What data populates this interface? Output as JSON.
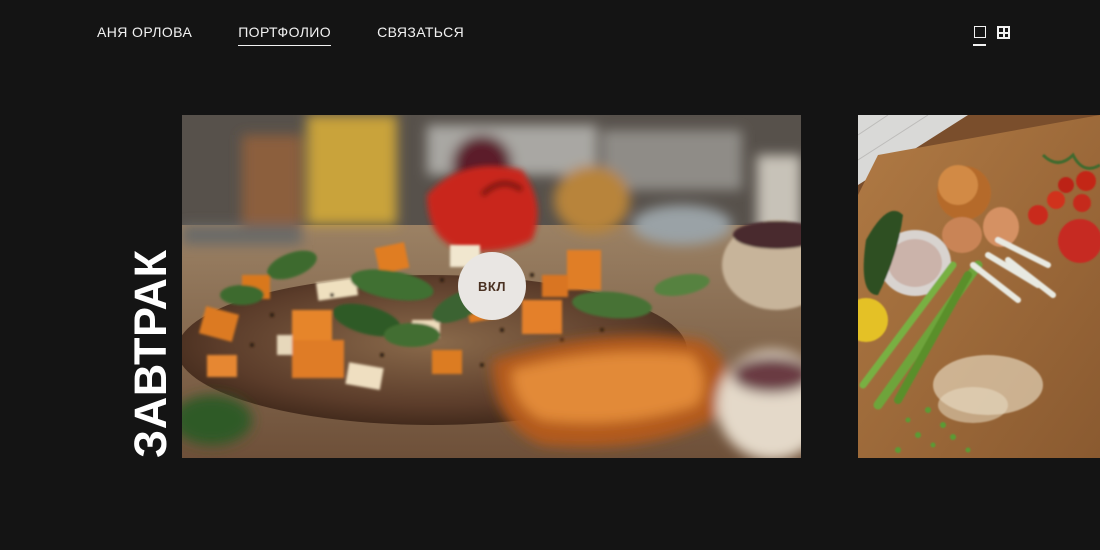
{
  "nav": {
    "items": [
      {
        "label": "АНЯ ОРЛОВА"
      },
      {
        "label": "ПОРТФОЛИО",
        "active": true
      },
      {
        "label": "СВЯЗАТЬСЯ"
      }
    ]
  },
  "view_toggle": {
    "icons": [
      "single-view-icon",
      "grid-view-icon"
    ],
    "selected": "single"
  },
  "category": {
    "title": "ЗАВТРАК"
  },
  "gallery": {
    "toggle_label": "ВКЛ"
  },
  "colors": {
    "background": "#141414",
    "text": "#f2f2f2",
    "toggle_bg": "#e9e6e3",
    "toggle_text": "#4a3122"
  }
}
